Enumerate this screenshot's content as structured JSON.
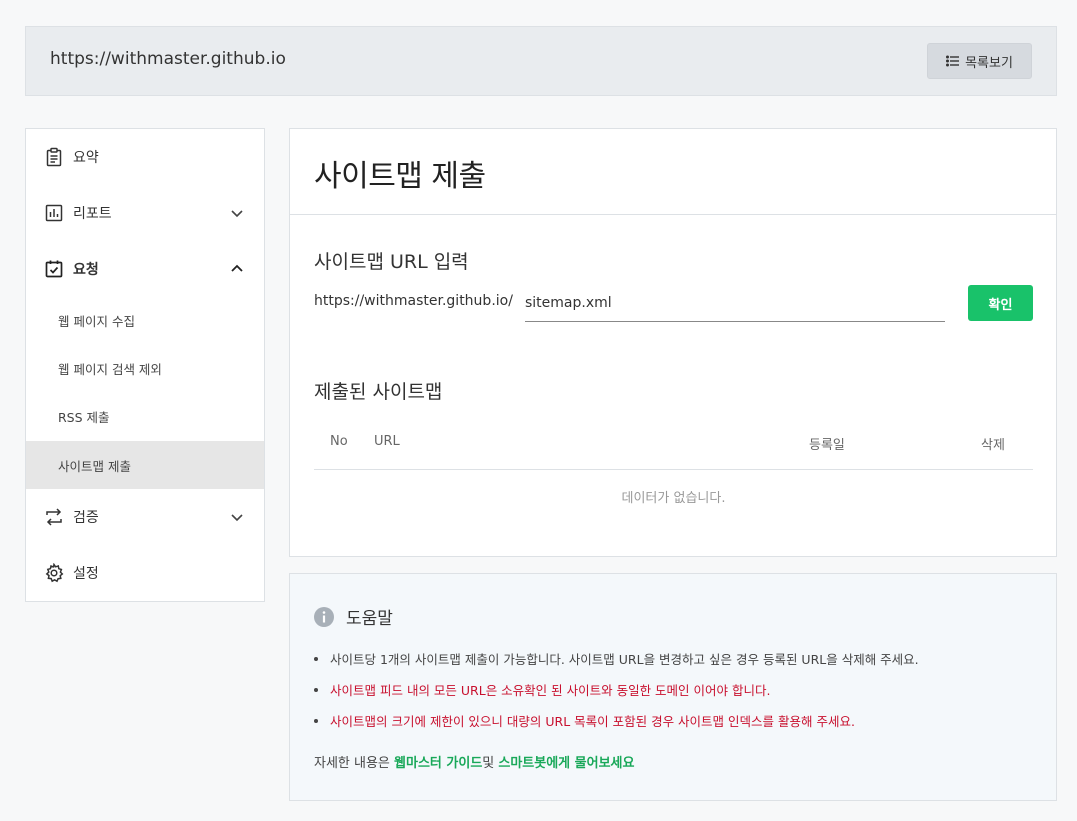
{
  "header": {
    "site_url": "https://withmaster.github.io",
    "list_button_label": "목록보기",
    "list_icon": "list-icon"
  },
  "sidebar": {
    "items": [
      {
        "label": "요약",
        "icon": "clipboard-icon"
      },
      {
        "label": "리포트",
        "icon": "bar-chart-icon"
      },
      {
        "label": "요청",
        "icon": "checklist-icon"
      },
      {
        "label": "검증",
        "icon": "repeat-icon"
      },
      {
        "label": "설정",
        "icon": "gear-icon"
      }
    ],
    "sub_items": [
      {
        "label": "웹 페이지 수집"
      },
      {
        "label": "웹 페이지 검색 제외"
      },
      {
        "label": "RSS 제출"
      },
      {
        "label": "사이트맵 제출",
        "active": true
      }
    ]
  },
  "main": {
    "title": "사이트맵 제출",
    "url_section_title": "사이트맵 URL 입력",
    "url_prefix": "https://withmaster.github.io/",
    "url_value": "sitemap.xml",
    "confirm_label": "확인",
    "submitted_section_title": "제출된 사이트맵",
    "table_headers": {
      "no": "No",
      "url": "URL",
      "date": "등록일",
      "delete": "삭제"
    },
    "empty_message": "데이터가 없습니다."
  },
  "help": {
    "title": "도움말",
    "bullets": [
      {
        "text": "사이트당 1개의 사이트맵 제출이 가능합니다. 사이트맵 URL을 변경하고 싶은 경우 등록된 URL을 삭제해 주세요."
      },
      {
        "text": "사이트맵 피드 내의 모든 URL은 소유확인 된 사이트와 동일한 도메인 이어야 합니다."
      },
      {
        "text": "사이트맵의 크기에 제한이 있으니 대량의 URL 목록이 포함된 경우 사이트맵 인덱스를 활용해 주세요."
      }
    ],
    "footer_prefix": "자세한 내용은 ",
    "guide_link": "웹마스터 가이드",
    "footer_mid": "및 ",
    "bot_link": "스마트봇에게 물어보세요"
  },
  "colors": {
    "accent_green": "#19c26a",
    "warning_red": "#c8102e"
  }
}
